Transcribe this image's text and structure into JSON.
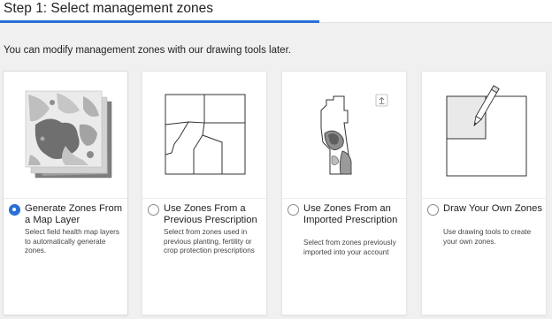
{
  "header": {
    "title": "Step 1: Select management zones"
  },
  "subtitle": "You can modify management zones with our drawing tools later.",
  "cards": [
    {
      "title": "Generate Zones From a Map Layer",
      "description": "Select field health map layers to automatically generate zones.",
      "selected": true,
      "icon": "map-layer-stack-icon"
    },
    {
      "title": "Use Zones From a Previous Prescription",
      "description": "Select from zones used in previous planting, fertility or crop protection prescriptions",
      "selected": false,
      "icon": "zone-boundaries-icon"
    },
    {
      "title": "Use Zones From an Imported Prescription",
      "description": "Select from zones previously imported into your account",
      "selected": false,
      "icon": "imported-field-icon"
    },
    {
      "title": "Draw Your Own Zones",
      "description": "Use drawing tools to create your own zones.",
      "selected": false,
      "icon": "pencil-draw-icon"
    }
  ],
  "colors": {
    "accent": "#2a6fd6",
    "zone_light": "#e9e9e9",
    "zone_mid": "#9a9a9a",
    "zone_dark": "#5f5f5f"
  }
}
